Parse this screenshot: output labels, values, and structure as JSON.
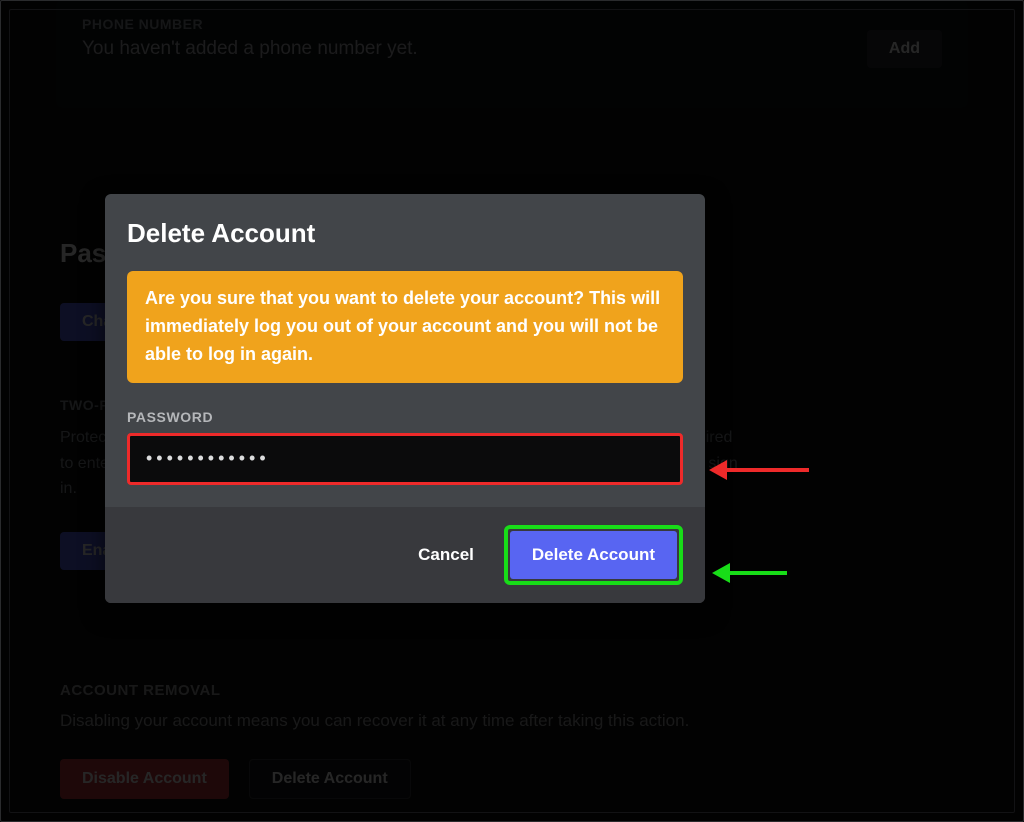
{
  "phone_section": {
    "label": "PHONE NUMBER",
    "value": "You haven't added a phone number yet.",
    "add_button": "Add"
  },
  "password_section": {
    "heading": "Password and Authentication",
    "change_button": "Change Password",
    "tfa_label": "TWO-FACTOR AUTHENTICATION",
    "tfa_desc": "Protect your Discord account with an extra layer of security. Once configured, you'll be required to enter both your password and an authentication code from your mobile phone in order to sign in.",
    "enable_button": "Enable Two-Factor Auth"
  },
  "account_removal": {
    "label": "ACCOUNT REMOVAL",
    "desc": "Disabling your account means you can recover it at any time after taking this action.",
    "disable_button": "Disable Account",
    "delete_button": "Delete Account"
  },
  "modal": {
    "title": "Delete Account",
    "warning": "Are you sure that you want to delete your account? This will immediately log you out of your account and you will not be able to log in again.",
    "password_label": "PASSWORD",
    "password_value": "••••••••••••",
    "cancel": "Cancel",
    "confirm": "Delete Account"
  },
  "colors": {
    "highlight_red": "#ee2a2a",
    "highlight_green": "#18dd18",
    "primary": "#5865F2",
    "warn": "#f0a31c"
  }
}
